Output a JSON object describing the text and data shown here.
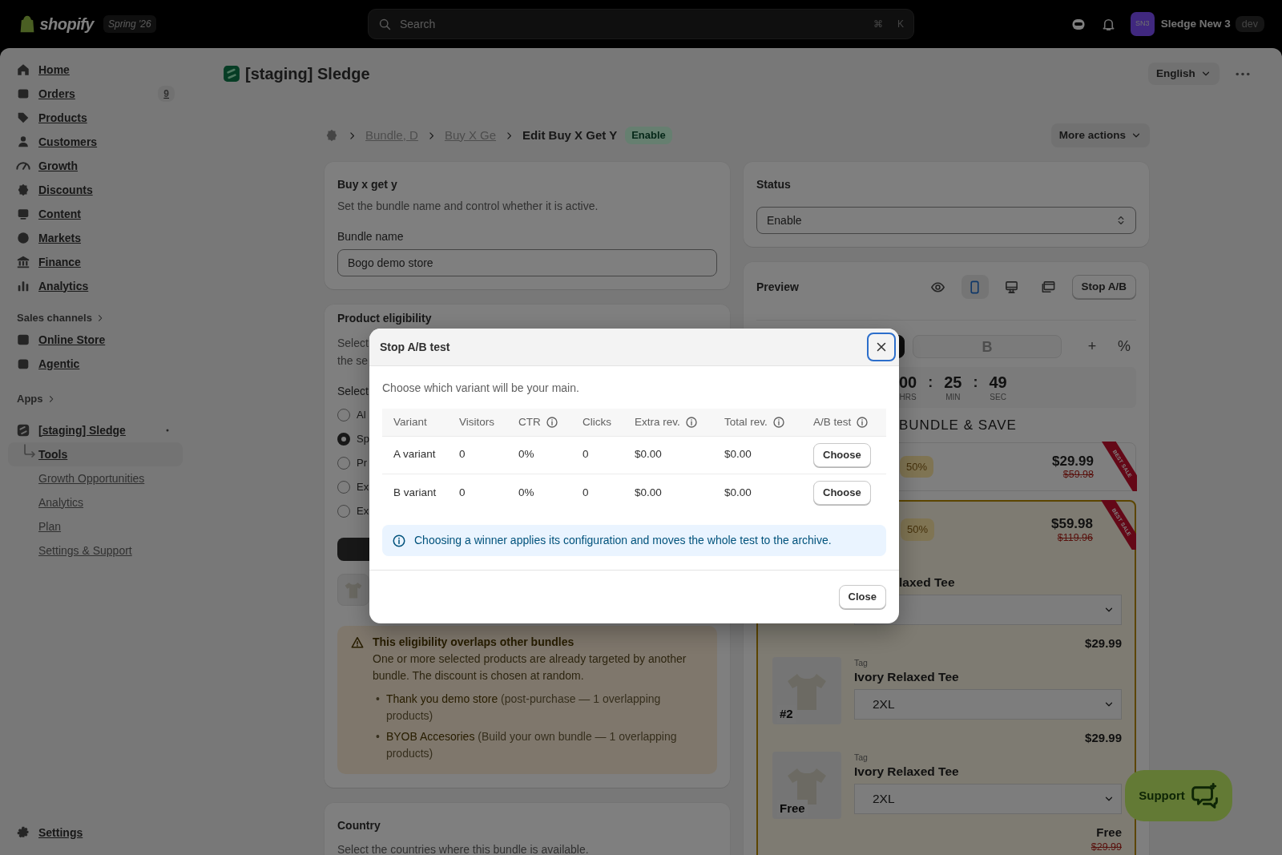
{
  "topbar": {
    "logo_text": "shopify",
    "edition": "Spring '26",
    "search": {
      "placeholder": "Search",
      "shortcut": [
        "⌘",
        "K"
      ]
    },
    "user": {
      "initials": "SN3",
      "name": "Sledge New 3",
      "badge": "dev"
    }
  },
  "sidebar": {
    "items": [
      {
        "label": "Home"
      },
      {
        "label": "Orders",
        "badge": "9"
      },
      {
        "label": "Products"
      },
      {
        "label": "Customers"
      },
      {
        "label": "Growth"
      },
      {
        "label": "Discounts"
      },
      {
        "label": "Content"
      },
      {
        "label": "Markets"
      },
      {
        "label": "Finance"
      },
      {
        "label": "Analytics"
      }
    ],
    "sales_channels": {
      "title": "Sales channels",
      "items": [
        {
          "label": "Online Store"
        },
        {
          "label": "Agentic"
        }
      ]
    },
    "apps": {
      "title": "Apps",
      "app": {
        "label": "[staging] Sledge",
        "pinned": true,
        "children": [
          {
            "label": "Tools",
            "selected": true
          },
          {
            "label": "Growth Opportunities",
            "selected": false
          },
          {
            "label": "Analytics",
            "selected": false
          },
          {
            "label": "Plan",
            "selected": false
          },
          {
            "label": "Settings & Support",
            "selected": false
          }
        ]
      }
    },
    "settings": "Settings"
  },
  "page": {
    "title": "[staging] Sledge",
    "language": "English"
  },
  "breadcrumb": {
    "crumbs": [
      "Bundle, D",
      "Buy X Ge"
    ],
    "current": "Edit Buy X Get Y",
    "status_badge": "Enable",
    "more_actions": "More actions"
  },
  "basics": {
    "title": "Buy x get y",
    "description": "Set the bundle name and control whether it is active.",
    "field_label": "Bundle name",
    "value": "Bogo demo store"
  },
  "eligibility": {
    "title": "Product eligibility",
    "description_lines": [
      "Select",
      "the se"
    ],
    "select_label": "Select",
    "options": [
      {
        "label": "Al",
        "selected": false
      },
      {
        "label": "Sp",
        "selected": true
      },
      {
        "label": "Pr",
        "selected": false
      },
      {
        "label": "Ex",
        "selected": false
      },
      {
        "label": "Ex",
        "selected": false
      }
    ]
  },
  "warning": {
    "bullet": "•",
    "title": "This eligibility overlaps other bundles",
    "text": "One or more selected products are already targeted by another bundle. The discount is chosen at random.",
    "items": [
      {
        "name": "Thank you demo store",
        "detail": "(post-purchase — 1 overlapping products)"
      },
      {
        "name": "BYOB Accesories",
        "detail": "(Build your own bundle — 1 overlapping products)"
      }
    ]
  },
  "country": {
    "title": "Country",
    "description": "Select the countries where this bundle is available."
  },
  "status": {
    "title": "Status",
    "value": "Enable"
  },
  "preview": {
    "title": "Preview",
    "view_buttons": [
      {
        "selected": false
      },
      {
        "selected": true
      },
      {
        "selected": false
      },
      {
        "selected": false
      }
    ],
    "stop_button": "Stop A/B",
    "variant_tabs": [
      {
        "selected": true
      },
      {
        "label": "B",
        "selected": false
      }
    ],
    "add": "+",
    "percent": "%",
    "timer": {
      "separator": ":",
      "parts": [
        {
          "value": "00",
          "unit": "HRS"
        },
        {
          "value": "25",
          "unit": "MIN"
        },
        {
          "value": "49",
          "unit": "SEC"
        }
      ]
    },
    "heading": "BUNDLE & SAVE",
    "offers": [
      {
        "discount": "50%",
        "price": "$29.99",
        "compare_price": "$59.98",
        "ribbon": "BEST SALE",
        "selected": false
      },
      {
        "discount": "50%",
        "price": "$59.98",
        "compare_price": "$119.96",
        "ribbon": "BEST SALE",
        "selected": true,
        "products": [
          {
            "name": "laxed Tee",
            "price": "$29.99"
          },
          {
            "tag": "Tag",
            "name": "Ivory Relaxed Tee",
            "variant": "2XL",
            "image_label": "#2",
            "price": "$29.99"
          },
          {
            "tag": "Tag",
            "name": "Ivory Relaxed Tee",
            "variant": "2XL",
            "image_label": "Free",
            "price": "Free",
            "compare_price": "$29.99"
          }
        ]
      }
    ]
  },
  "support": "Support",
  "modal": {
    "title": "Stop A/B test",
    "intro": "Choose which variant will be your main.",
    "columns": [
      {
        "label": "Variant",
        "info": false
      },
      {
        "label": "Visitors",
        "info": false
      },
      {
        "label": "CTR",
        "info": true
      },
      {
        "label": "Clicks",
        "info": false
      },
      {
        "label": "Extra rev.",
        "info": true
      },
      {
        "label": "Total rev.",
        "info": true
      },
      {
        "label": "A/B test",
        "info": true
      }
    ],
    "rows": [
      {
        "cells": [
          "A variant",
          "0",
          "0%",
          "0",
          "$0.00",
          "$0.00"
        ],
        "action": "Choose"
      },
      {
        "cells": [
          "B variant",
          "0",
          "0%",
          "0",
          "$0.00",
          "$0.00"
        ],
        "action": "Choose"
      }
    ],
    "notice": "Choosing a winner applies its configuration and moves the whole test to the archive.",
    "close_button": "Close"
  }
}
